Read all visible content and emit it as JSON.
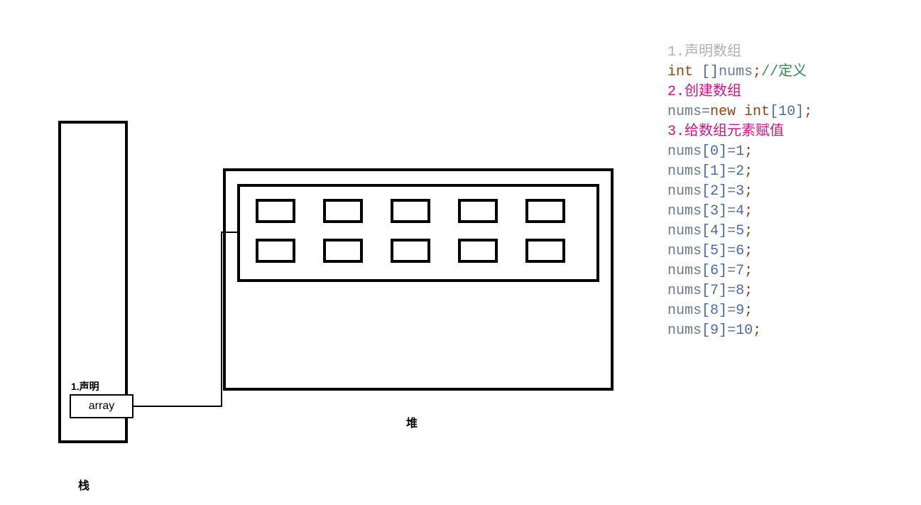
{
  "diagram": {
    "stack_label": "栈",
    "heap_label": "堆",
    "declare_label": "1.声明",
    "array_text": "array"
  },
  "code": {
    "line1": "1.声明数组",
    "line2_int": "int ",
    "line2_brk": "[]",
    "line2_nums": "nums",
    "line2_semi": ";",
    "line2_comment": "//定义",
    "line3": "2.创建数组",
    "line4_pre": " nums",
    "line4_eq": "=",
    "line4_new": "new ",
    "line4_int": "int",
    "line4_lb": "[",
    "line4_ten": "10",
    "line4_rb": "]",
    "line4_semi": ";",
    "line5": "3.给数组元素赋值",
    "assigns": [
      {
        "idx": "0",
        "val": "1"
      },
      {
        "idx": "1",
        "val": "2"
      },
      {
        "idx": "2",
        "val": "3"
      },
      {
        "idx": "3",
        "val": "4"
      },
      {
        "idx": "4",
        "val": "5"
      },
      {
        "idx": "5",
        "val": "6"
      },
      {
        "idx": "6",
        "val": "7"
      },
      {
        "idx": "7",
        "val": "8"
      },
      {
        "idx": "8",
        "val": "9"
      },
      {
        "idx": "9",
        "val": "10"
      }
    ]
  }
}
